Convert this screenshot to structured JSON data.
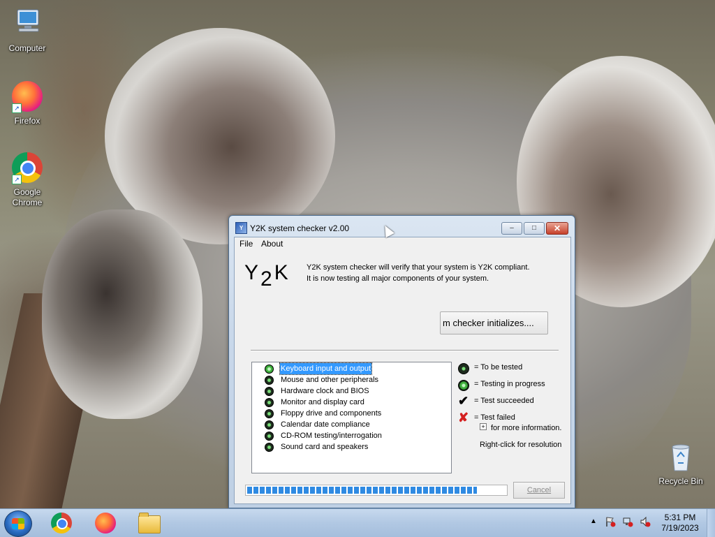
{
  "desktop": {
    "icons": [
      {
        "label": "Computer"
      },
      {
        "label": "Firefox"
      },
      {
        "label": "Google\nChrome"
      },
      {
        "label": "Recycle Bin"
      }
    ]
  },
  "window": {
    "title": "Y2K system checker v2.00",
    "menu": {
      "file": "File",
      "about": "About"
    },
    "logo": {
      "y": "Y",
      "two": "2",
      "k": "K"
    },
    "intro": {
      "line1": "Y2K system checker will verify that your system is Y2K compliant.",
      "line2": "It is now testing all major components of your system."
    },
    "status_text": "m checker initializes....",
    "tests": [
      {
        "label": "Keyboard input and output",
        "state": "in_progress",
        "selected": true
      },
      {
        "label": "Mouse and other peripherals",
        "state": "to_be_tested"
      },
      {
        "label": "Hardware clock and BIOS",
        "state": "to_be_tested"
      },
      {
        "label": "Monitor and display card",
        "state": "to_be_tested"
      },
      {
        "label": "Floppy drive and components",
        "state": "to_be_tested"
      },
      {
        "label": "Calendar date compliance",
        "state": "to_be_tested"
      },
      {
        "label": "CD-ROM testing/interrogation",
        "state": "to_be_tested"
      },
      {
        "label": "Sound card and speakers",
        "state": "to_be_tested"
      }
    ],
    "legend": {
      "to_be_tested": "= To be tested",
      "testing": "= Testing in progress",
      "succeeded": "= Test succeeded",
      "failed": "= Test failed",
      "more_info": "for more information.",
      "right_click": "Right-click for resolution"
    },
    "progress_fraction": 0.89,
    "cancel_label": "Cancel",
    "controls": {
      "minimize": "–",
      "maximize": "□",
      "close": "✕"
    }
  },
  "taskbar": {
    "apps": [
      {
        "icon": "chrome-icon"
      },
      {
        "icon": "firefox-icon"
      },
      {
        "icon": "file-explorer-icon"
      }
    ],
    "clock": {
      "time": "5:31 PM",
      "date": "7/19/2023"
    }
  },
  "colors": {
    "selection": "#3399ff",
    "progress": "#2f8ae2",
    "fail": "#d42020"
  }
}
